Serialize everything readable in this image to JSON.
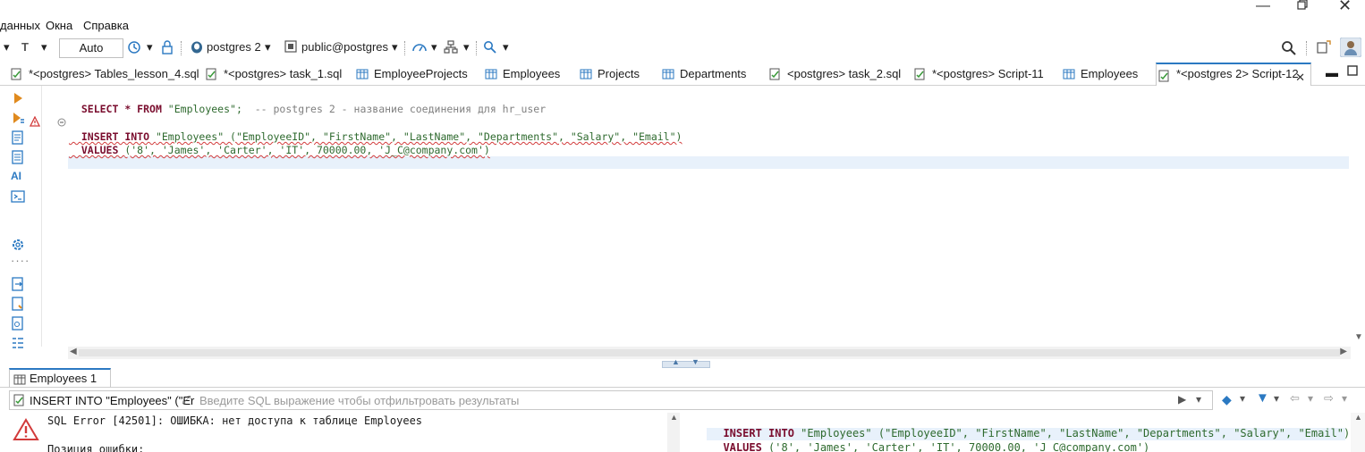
{
  "menu": {
    "items": [
      "данных",
      "Окна",
      "Справка"
    ]
  },
  "toolbar": {
    "auto_label": "Auto",
    "connection_label": "postgres 2",
    "schema_label": "public@postgres"
  },
  "tabs": [
    {
      "label": "*<postgres> Tables_lesson_4.sql",
      "icon": "sql-script-icon"
    },
    {
      "label": "*<postgres> task_1.sql",
      "icon": "sql-script-icon"
    },
    {
      "label": "EmployeeProjects",
      "icon": "table-icon"
    },
    {
      "label": "Employees",
      "icon": "table-icon"
    },
    {
      "label": "Projects",
      "icon": "table-icon"
    },
    {
      "label": "Departments",
      "icon": "table-icon"
    },
    {
      "label": "<postgres> task_2.sql",
      "icon": "sql-script-icon"
    },
    {
      "label": "*<postgres> Script-11",
      "icon": "sql-script-icon"
    },
    {
      "label": "Employees",
      "icon": "table-icon"
    },
    {
      "label": "*<postgres 2> Script-12",
      "icon": "sql-script-icon",
      "active": true
    }
  ],
  "editor": {
    "line1_select": "SELECT * FROM ",
    "line1_table": "\"Employees\";",
    "line1_comment": "  -- postgres 2 - название соединения для hr_user",
    "line2_kw": "INSERT INTO ",
    "line2_rest": "\"Employees\" (\"EmployeeID\", \"FirstName\", \"LastName\", \"Departments\", \"Salary\", \"Email\")",
    "line3_kw": "VALUES ",
    "line3_rest": "('8', 'James', 'Carter', 'IT', 70000.00, 'J_C@company.com')"
  },
  "results": {
    "tab_label": "Employees 1",
    "filter_query": "INSERT INTO \"Employees\" (\"Er",
    "filter_placeholder": "Введите SQL выражение чтобы отфильтровать результаты",
    "error_line1": "SQL Error [42501]: ОШИБКА: нет доступа к таблице Employees",
    "error_line3": "Позиция ошибки:",
    "sql_line1_kw": "INSERT INTO ",
    "sql_line1_rest": "\"Employees\" (\"EmployeeID\", \"FirstName\", \"LastName\", \"Departments\", \"Salary\", \"Email\")",
    "sql_line2_kw": "VALUES ",
    "sql_line2_rest": "('8', 'James', 'Carter', 'IT', 70000.00, 'J_C@company.com')"
  },
  "colors": {
    "accent": "#2b79c2",
    "keyword": "#7a0d2e",
    "string": "#2e6a2e",
    "error": "#d23b3b"
  }
}
